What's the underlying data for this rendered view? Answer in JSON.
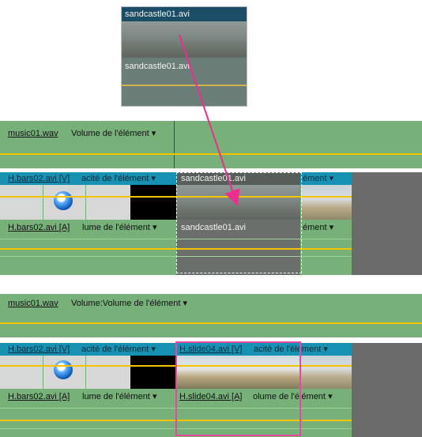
{
  "top_clip": {
    "title": "sandcastle01.avi",
    "audio_label": "sandcastle01.avi"
  },
  "timeline_top": {
    "audio_track": {
      "clip": "music01.wav",
      "label": "Volume de l'élément",
      "dropdown": "▾"
    },
    "video_track": {
      "clip1": "H.bars02.avi [V]",
      "clip1_label": "acité de l'élément",
      "dropdown": "▾",
      "drop_clip": "sandcastle01.avi",
      "clip2_label": "ément"
    },
    "audio_track_2": {
      "clip1": "H.bars02.avi [A]",
      "clip1_label": "lume de l'élément",
      "drop_clip": "sandcastle01.avi",
      "clip2_label": "ément",
      "dropdown": "▾"
    }
  },
  "timeline_bottom": {
    "audio_track": {
      "clip": "music01.wav",
      "label": "Volume:Volume de l'élément",
      "dropdown": "▾"
    },
    "video_track": {
      "clip1": "H.bars02.avi [V]",
      "clip1_label": "acité de l'élément",
      "dropdown": "▾",
      "inserted_clip": "H.slide04.avi [V]",
      "inserted_label": "acité de l'élément"
    },
    "audio_track_2": {
      "clip1": "H.bars02.avi [A]",
      "clip1_label": "lume de l'élément",
      "inserted_clip": "H.slide04.avi [A]",
      "inserted_label": "olume de l'élément",
      "dropdown": "▾"
    }
  },
  "colors": {
    "track_green": "#78b07a",
    "video_header": "#2b6e83",
    "selection": "#e64a9f",
    "gold_line": "#f5c400"
  }
}
